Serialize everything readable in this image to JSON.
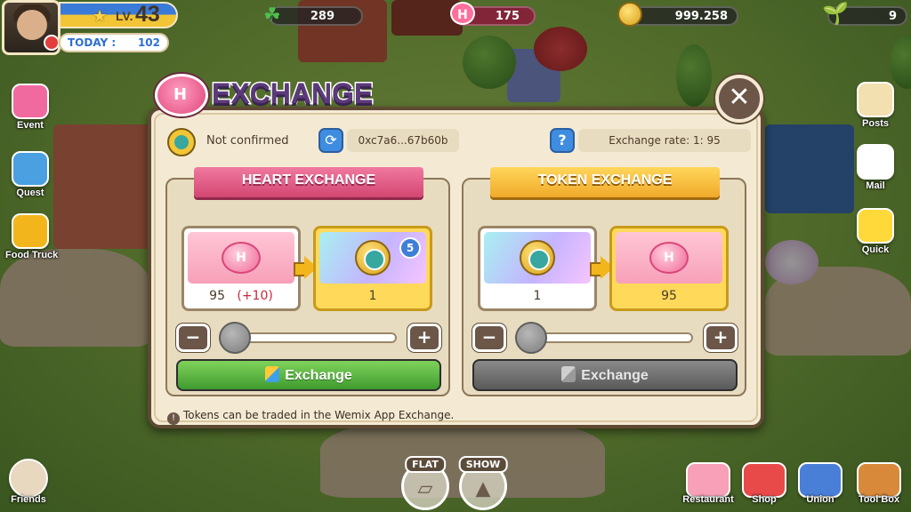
{
  "hud": {
    "level_label": "LV.",
    "level": "43",
    "today_label": "TODAY :",
    "today_value": "102",
    "clover": "289",
    "hearts": "175",
    "coins": "999.258",
    "sprouts": "9",
    "heart_icon_letter": "H"
  },
  "left_menu": [
    {
      "label": "Event",
      "icon": "party-popper-icon",
      "color": "#f06aa0"
    },
    {
      "label": "Quest",
      "icon": "quest-book-icon",
      "color": "#4aa0e0"
    },
    {
      "label": "Food Truck",
      "icon": "food-truck-icon",
      "color": "#f2b61c"
    }
  ],
  "right_menu": [
    {
      "label": "Posts",
      "icon": "notepad-icon",
      "color": "#f2e0b0"
    },
    {
      "label": "Mail",
      "icon": "mail-icon",
      "color": "#ffffff"
    },
    {
      "label": "Quick",
      "icon": "duck-icon",
      "color": "#ffd93a"
    }
  ],
  "bottom_left": {
    "label": "Friends",
    "icon": "friends-icon"
  },
  "modes": [
    {
      "tag": "FLAT",
      "icon": "flat-box-icon",
      "glyph": "▱"
    },
    {
      "tag": "SHOW",
      "icon": "silhouette-icon",
      "glyph": "▲"
    }
  ],
  "bottom_right": [
    {
      "label": "Restaurant",
      "icon": "chef-hat-icon",
      "color": "#f7a0b8"
    },
    {
      "label": "Shop",
      "icon": "shop-icon",
      "color": "#e84a4a"
    },
    {
      "label": "Union",
      "icon": "union-badge-icon",
      "color": "#4a7fd8"
    },
    {
      "label": "Tool Box",
      "icon": "toolbox-icon",
      "color": "#d8893a"
    }
  ],
  "dialog": {
    "title": "EXCHANGE",
    "title_icon_letter": "H",
    "close_glyph": "✕",
    "wallet_status": "Not confirmed",
    "refresh_glyph": "⟳",
    "wallet_address": "0xc7a6...67b60b",
    "help_glyph": "?",
    "exchange_rate": "Exchange rate: 1: 95",
    "footnote_glyph": "!",
    "footnote": "Tokens can be traded in the Wemix App Exchange.",
    "heart_exchange": {
      "title": "HEART EXCHANGE",
      "from_amount": "95",
      "from_bonus": "(+10)",
      "to_amount": "1",
      "to_badge": "5",
      "heart_letter": "H",
      "minus": "−",
      "plus": "+",
      "button": "Exchange",
      "slider_fraction": 0.0
    },
    "token_exchange": {
      "title": "TOKEN EXCHANGE",
      "from_amount": "1",
      "to_amount": "95",
      "heart_letter": "H",
      "minus": "−",
      "plus": "+",
      "button": "Exchange",
      "slider_fraction": 0.0
    }
  },
  "colors": {
    "dialog_bg": "#f4ead4",
    "dialog_border": "#5e4a32",
    "heart_ribbon": "#d34672",
    "token_ribbon": "#f0a92a",
    "exchange_green": "#3f9a2f",
    "exchange_disabled": "#5a5a5a",
    "title": "#5c3a7a"
  }
}
